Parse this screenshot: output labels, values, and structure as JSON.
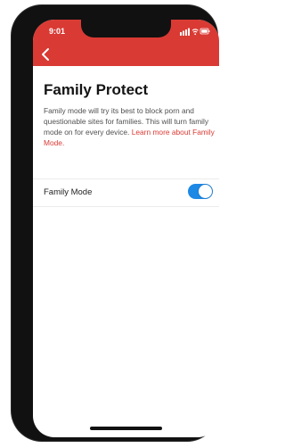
{
  "status_bar": {
    "time": "9:01"
  },
  "header": {
    "back_icon": "chevron-left-icon"
  },
  "page": {
    "title": "Family Protect",
    "description": "Family mode will try its best to block porn and questionable sites for families. This will turn family mode on for every device.",
    "learn_more_link": "Learn more about Family Mode."
  },
  "settings": {
    "family_mode_label": "Family Mode",
    "family_mode_enabled": true
  },
  "colors": {
    "accent": "#d93a34",
    "toggle_on": "#1e88e5",
    "text_primary": "#141414",
    "text_secondary": "#505050"
  }
}
